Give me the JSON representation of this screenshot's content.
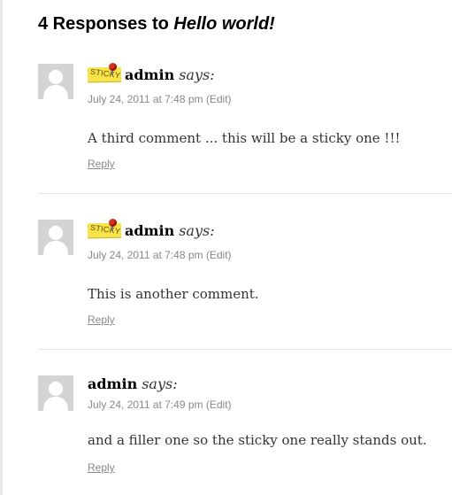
{
  "heading": {
    "prefix": "4 Responses to ",
    "post_title": "Hello world!"
  },
  "comments": [
    {
      "sticky": true,
      "sticky_label": "STICKY",
      "author": "admin",
      "says": "says:",
      "timestamp": "July 24, 2011 at 7:48 pm",
      "edit": "(Edit)",
      "text": "A third comment ... this will be a sticky one !!!",
      "reply": "Reply"
    },
    {
      "sticky": true,
      "sticky_label": "STICKY",
      "author": "admin",
      "says": "says:",
      "timestamp": "July 24, 2011 at 7:48 pm",
      "edit": "(Edit)",
      "text": "This is another comment.",
      "reply": "Reply"
    },
    {
      "sticky": false,
      "author": "admin",
      "says": "says:",
      "timestamp": "July 24, 2011 at 7:49 pm",
      "edit": "(Edit)",
      "text": "and a filler one so the sticky one really stands out.",
      "reply": "Reply"
    }
  ]
}
